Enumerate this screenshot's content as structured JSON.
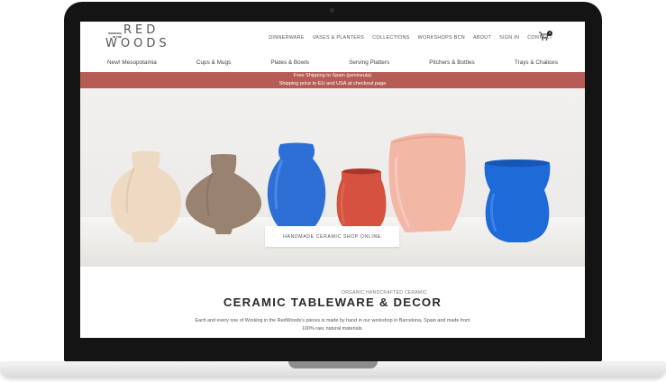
{
  "brand": {
    "small_line1": "WORKING",
    "small_line2": "IN THE",
    "big_line1": "RED",
    "big_line2": "WOODS"
  },
  "top_nav": [
    "DINNERWARE",
    "VASES & PLANTERS",
    "COLLECTIONS",
    "WORKSHOPS BCN",
    "ABOUT",
    "SIGN IN",
    "CONTACT"
  ],
  "cart": {
    "icon": "cart-icon",
    "count": "0"
  },
  "categories": [
    "New! Mesopotamia",
    "Cups & Mugs",
    "Plates & Bowls",
    "Serving Platters",
    "Pitchers & Bottles",
    "Trays & Chalices"
  ],
  "banner": {
    "line1": "Free Shipping to Spain (peninsula)",
    "line2": "Shipping price to EU and USA at checkout page",
    "color": "#b65c55"
  },
  "hero": {
    "button_label": "HANDMADE CERAMIC SHOP ONLINE"
  },
  "intro": {
    "kicker": "ORGANIC HANDCRAFTED CERAMIC",
    "title": "CERAMIC TABLEWARE & DECOR",
    "description": "Each and every one of Working in the RedWoods's pieces is made by hand in our workshop in Barcelona, Spain and made from 100% raw, natural materials."
  }
}
